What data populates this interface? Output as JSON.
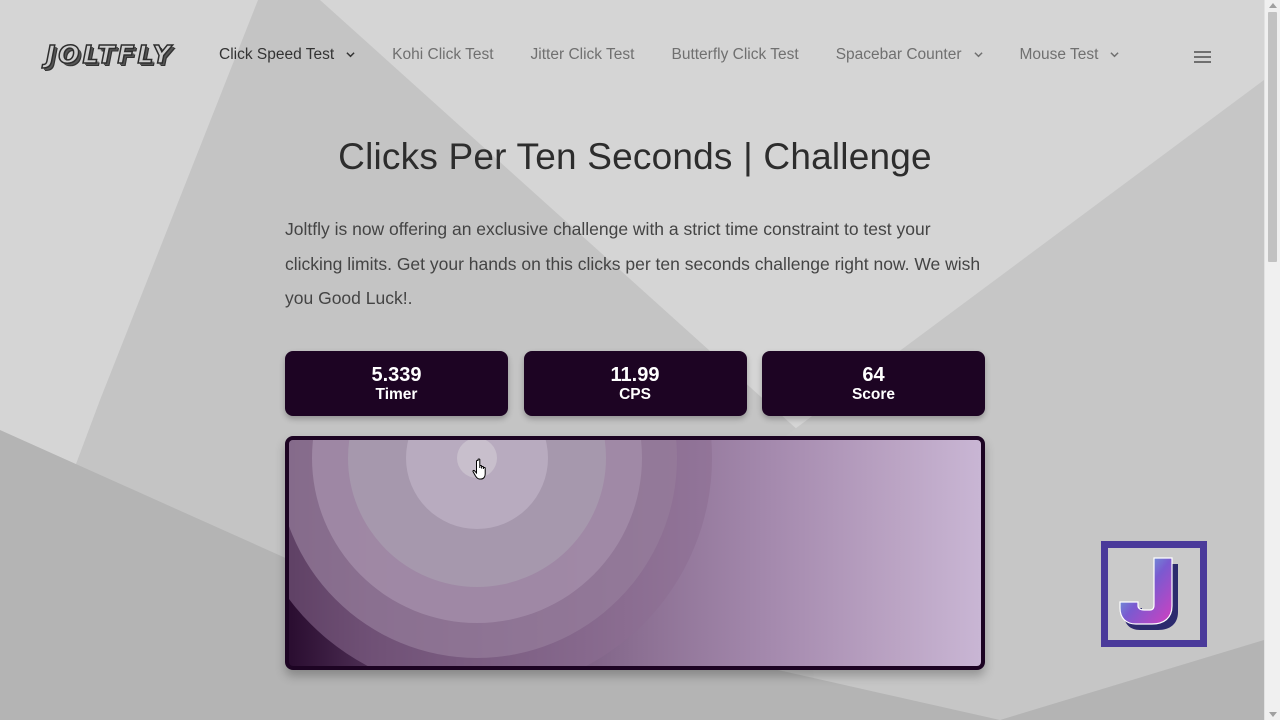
{
  "header": {
    "logo": "JOLTFLY",
    "nav": [
      {
        "label": "Click Speed Test",
        "dropdown": true,
        "active": true
      },
      {
        "label": "Kohi Click Test",
        "dropdown": false
      },
      {
        "label": "Jitter Click Test",
        "dropdown": false
      },
      {
        "label": "Butterfly Click Test",
        "dropdown": false
      },
      {
        "label": "Spacebar Counter",
        "dropdown": true
      },
      {
        "label": "Mouse Test",
        "dropdown": true
      }
    ],
    "menu_icon": "hamburger-icon"
  },
  "main": {
    "title": "Clicks Per Ten Seconds | Challenge",
    "description": "Joltfly is now offering an exclusive challenge with a strict time constraint to test your clicking limits. Get your hands on this clicks per ten seconds challenge right now. We wish you Good Luck!.",
    "stats": [
      {
        "value": "5.339",
        "label": "Timer"
      },
      {
        "value": "11.99",
        "label": "CPS"
      },
      {
        "value": "64",
        "label": "Score"
      }
    ],
    "click_area": {
      "cursor_icon": "hand-pointer-icon"
    }
  },
  "badge": {
    "icon": "joltfly-j-logo-icon"
  },
  "colors": {
    "stat_bg": "#1d0423",
    "badge_border": "#4a3a9a",
    "page_bg": "#d4d4d4"
  }
}
